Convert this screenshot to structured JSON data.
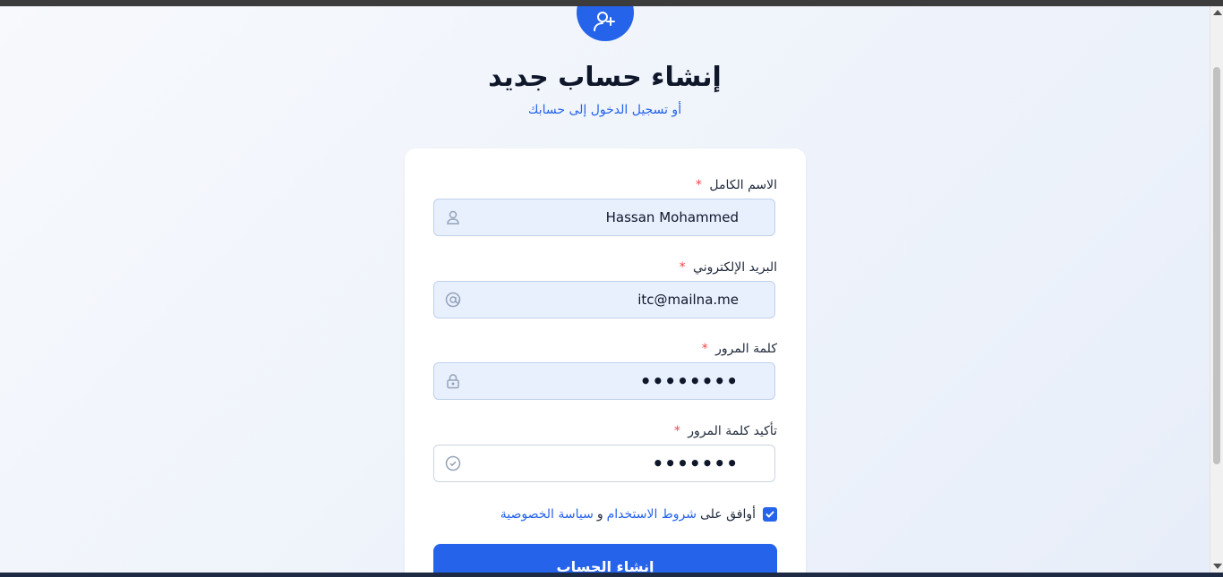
{
  "header": {
    "title": "إنشاء حساب جديد",
    "subtitle": "أو تسجيل الدخول إلى حسابك"
  },
  "form": {
    "full_name": {
      "label": "الاسم الكامل",
      "required_mark": "*",
      "value": "Hassan Mohammed",
      "icon": "user-icon"
    },
    "email": {
      "label": "البريد الإلكتروني",
      "required_mark": "*",
      "value": "itc@mailna.me",
      "icon": "at-sign-icon"
    },
    "password": {
      "label": "كلمة المرور",
      "required_mark": "*",
      "value": "••••••••",
      "icon": "lock-icon"
    },
    "confirm_password": {
      "label": "تأكيد كلمة المرور",
      "required_mark": "*",
      "value": "•••••••",
      "icon": "check-circle-icon"
    },
    "terms": {
      "checked": true,
      "prefix": "أوافق على",
      "terms_link": "شروط الاستخدام",
      "conjunction": "و",
      "privacy_link": "سياسة الخصوصية"
    },
    "submit_label": "إنشاء الحساب"
  },
  "colors": {
    "accent": "#2563eb",
    "required": "#ef4444",
    "autofill_bg": "#e8f0fe",
    "title": "#0f172a"
  }
}
